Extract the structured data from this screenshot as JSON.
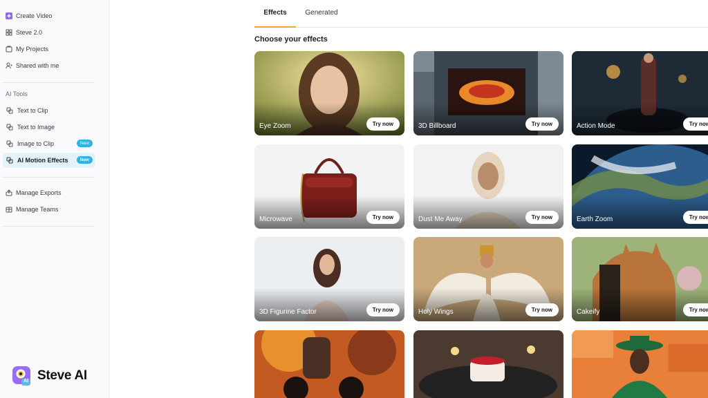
{
  "sidebar": {
    "top_items": [
      {
        "label": "Create Video",
        "icon": "plus-square-icon"
      },
      {
        "label": "Steve 2.0",
        "icon": "grid-icon"
      },
      {
        "label": "My Projects",
        "icon": "folder-icon"
      },
      {
        "label": "Shared with me",
        "icon": "user-share-icon"
      }
    ],
    "section_label": "AI Tools",
    "ai_tools": [
      {
        "label": "Text to Clip",
        "icon": "clip-icon",
        "badge": ""
      },
      {
        "label": "Text to Image",
        "icon": "image-icon",
        "badge": ""
      },
      {
        "label": "Image to Clip",
        "icon": "clip-icon",
        "badge": "New"
      },
      {
        "label": "AI Motion Effects",
        "icon": "motion-icon",
        "badge": "New",
        "active": true
      }
    ],
    "manage_items": [
      {
        "label": "Manage Exports",
        "icon": "export-icon"
      },
      {
        "label": "Manage Teams",
        "icon": "team-icon"
      }
    ],
    "logo_text": "Steve AI",
    "logo_badge": "AI"
  },
  "tabs": [
    {
      "label": "Effects",
      "active": true
    },
    {
      "label": "Generated",
      "active": false
    }
  ],
  "heading": "Choose your effects",
  "try_label": "Try now",
  "cards": [
    {
      "label": "Eye Zoom"
    },
    {
      "label": "3D Billboard"
    },
    {
      "label": "Action Mode"
    },
    {
      "label": "Microwave"
    },
    {
      "label": "Dust Me Away"
    },
    {
      "label": "Earth Zoom"
    },
    {
      "label": "3D Figurine Factor"
    },
    {
      "label": "Holy Wings"
    },
    {
      "label": "Cakeify"
    },
    {
      "label": ""
    },
    {
      "label": ""
    },
    {
      "label": ""
    }
  ],
  "colors": {
    "accent_tab": "#f0a53a",
    "badge": "#2fb3e8",
    "active_item_bg": "#e4f3fb"
  }
}
